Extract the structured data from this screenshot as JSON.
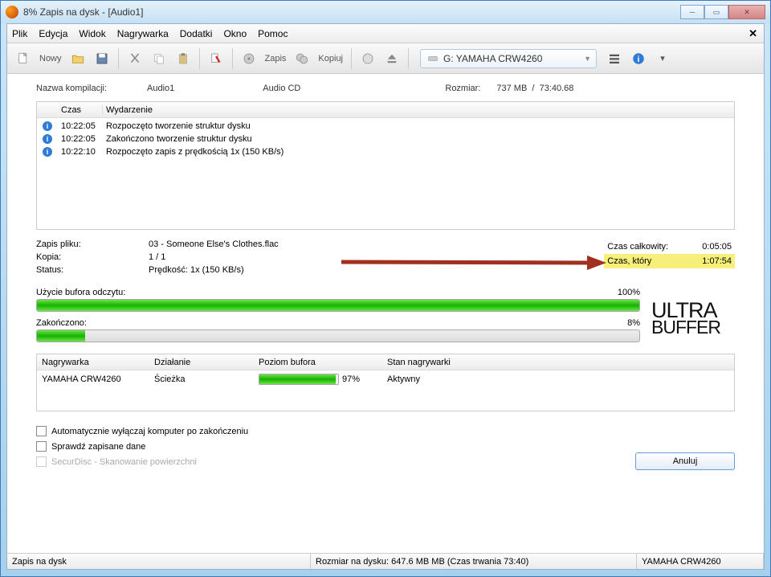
{
  "window": {
    "title": "8% Zapis na dysk - [Audio1]"
  },
  "menu": {
    "items": [
      "Plik",
      "Edycja",
      "Widok",
      "Nagrywarka",
      "Dodatki",
      "Okno",
      "Pomoc"
    ]
  },
  "toolbar": {
    "new_label": "Nowy",
    "burn_label": "Zapis",
    "copy_label": "Kopiuj",
    "drive": "G: YAMAHA CRW4260"
  },
  "comp": {
    "name_label": "Nazwa kompilacji:",
    "name_value": "Audio1",
    "type": "Audio CD",
    "size_label": "Rozmiar:",
    "size_value": "737 MB",
    "duration": "73:40.68"
  },
  "log": {
    "col_time": "Czas",
    "col_event": "Wydarzenie",
    "rows": [
      {
        "time": "10:22:05",
        "event": "Rozpoczęto tworzenie struktur dysku"
      },
      {
        "time": "10:22:05",
        "event": "Zakończono tworzenie struktur dysku"
      },
      {
        "time": "10:22:10",
        "event": "Rozpoczęto zapis z prędkością 1x (150 KB/s)"
      }
    ]
  },
  "status": {
    "file_label": "Zapis pliku:",
    "file": "03 - Someone Else's Clothes.flac",
    "copy_label": "Kopia:",
    "copy": "1 / 1",
    "status_label": "Status:",
    "speed": "Prędkość: 1x (150 KB/s)",
    "total_label": "Czas całkowity:",
    "total_value": "0:05:05",
    "remain_label": "Czas, który",
    "remain_value": "1:07:54"
  },
  "buffer": {
    "use_label": "Użycie bufora odczytu:",
    "use_pct": "100%",
    "done_label": "Zakończono:",
    "done_pct": "8%",
    "logo1": "ULTRA",
    "logo2": "BUFFER"
  },
  "burner": {
    "h1": "Nagrywarka",
    "h2": "Działanie",
    "h3": "Poziom bufora",
    "h4": "Stan nagrywarki",
    "name": "YAMAHA CRW4260",
    "action": "Ścieżka",
    "level": "97%",
    "state": "Aktywny"
  },
  "checks": {
    "c1": "Automatycznie wyłączaj komputer po zakończeniu",
    "c2": "Sprawdź zapisane dane",
    "c3": "SecurDisc - Skanowanie powierzchni"
  },
  "button": {
    "cancel": "Anuluj"
  },
  "statusbar": {
    "s1": "Zapis na dysk",
    "s2": "Rozmiar na dysku: 647.6 MB MB (Czas trwania 73:40)",
    "s3": "YAMAHA   CRW4260"
  }
}
